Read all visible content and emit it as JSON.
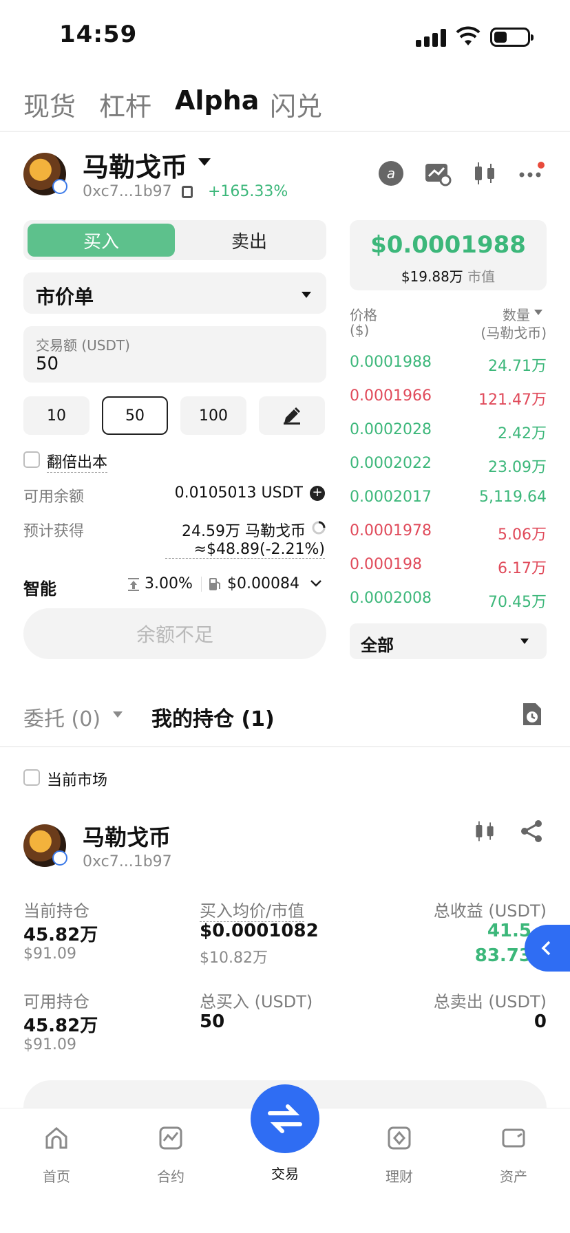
{
  "status_bar": {
    "time": "14:59"
  },
  "top_tabs": [
    "现货",
    "杠杆",
    "Alpha",
    "闪兑"
  ],
  "token": {
    "name": "马勒戈币",
    "address": "0xc7...1b97",
    "change": "+165.33%"
  },
  "trade": {
    "buy_label": "买入",
    "sell_label": "卖出",
    "order_type": "市价单",
    "amount_label": "交易额 (USDT)",
    "amount_value": "50",
    "presets": [
      "10",
      "50",
      "100"
    ],
    "double_principal": "翻倍出本",
    "available_label": "可用余额",
    "available_value": "0.0105013 USDT",
    "estimate_label": "预计获得",
    "estimate_value": "24.59万 马勒戈币",
    "estimate_usd": "≈$48.89(-2.21%)",
    "smart_label": "智能",
    "slippage": "3.00%",
    "gas": "$0.00084",
    "submit_label": "余额不足"
  },
  "market": {
    "price": "$0.0001988",
    "mcap_value": "$19.88万",
    "mcap_label": "市值",
    "price_header": "价格",
    "price_unit": "($)",
    "qty_header": "数量",
    "qty_unit": "(马勒戈币)",
    "trades": [
      {
        "price": "0.0001988",
        "qty": "24.71万",
        "side": "buy"
      },
      {
        "price": "0.0001966",
        "qty": "121.47万",
        "side": "sell"
      },
      {
        "price": "0.0002028",
        "qty": "2.42万",
        "side": "buy"
      },
      {
        "price": "0.0002022",
        "qty": "23.09万",
        "side": "buy"
      },
      {
        "price": "0.0002017",
        "qty": "5,119.64",
        "side": "buy"
      },
      {
        "price": "0.0001978",
        "qty": "5.06万",
        "side": "sell"
      },
      {
        "price": "0.000198",
        "qty": "6.17万",
        "side": "sell"
      },
      {
        "price": "0.0002008",
        "qty": "70.45万",
        "side": "buy"
      }
    ],
    "filter": "全部"
  },
  "orders": {
    "tab_orders": "委托 (0)",
    "tab_positions": "我的持仓 (1)",
    "current_market": "当前市场"
  },
  "position": {
    "name": "马勒戈币",
    "address": "0xc7...1b97",
    "holding_label": "当前持仓",
    "holding_value": "45.82万",
    "holding_usd": "$91.09",
    "avg_label": "买入均价/市值",
    "avg_value": "$0.0001082",
    "avg_mcap": "$10.82万",
    "pnl_label": "总收益 (USDT)",
    "pnl_value": "41.5",
    "pnl_pct": "83.73",
    "available_label": "可用持仓",
    "available_value": "45.82万",
    "available_usd": "$91.09",
    "total_buy_label": "总买入 (USDT)",
    "total_buy_value": "50",
    "total_sell_label": "总卖出 (USDT)",
    "total_sell_value": "0"
  },
  "nav": [
    "首页",
    "合约",
    "交易",
    "理财",
    "资产"
  ],
  "colors": {
    "green": "#3cb77a",
    "red": "#e04a5a",
    "blue": "#2f6df3"
  }
}
